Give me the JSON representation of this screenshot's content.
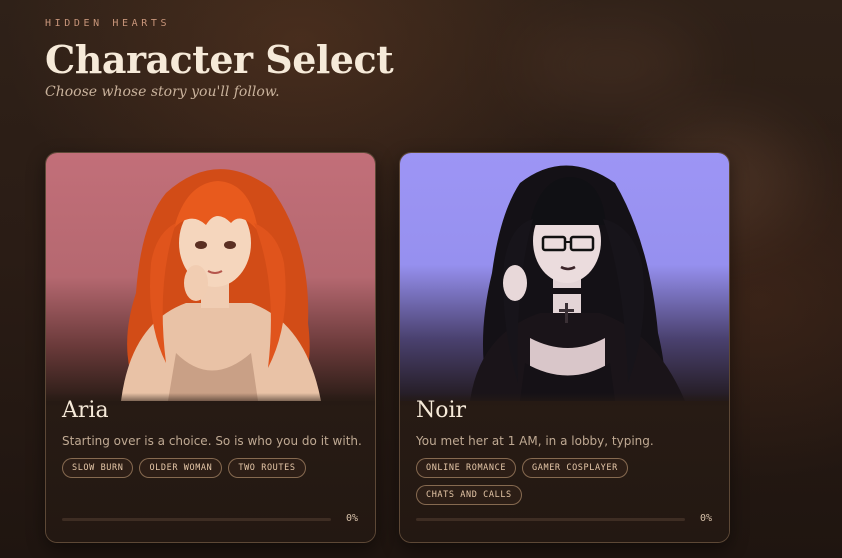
{
  "header": {
    "kicker": "HIDDEN HEARTS",
    "title": "Character Select",
    "subtitle": "Choose whose story you'll follow."
  },
  "characters": [
    {
      "name": "Aria",
      "tagline": "Starting over is a choice. So is who you do it with.",
      "tags": [
        "SLOW BURN",
        "OLDER WOMAN",
        "TWO ROUTES"
      ],
      "progress_label": "0%",
      "progress": 0,
      "art_bg": "#c26f79",
      "hair_color": "#e0541c",
      "portrait_icon": "red-haired-woman-portrait"
    },
    {
      "name": "Noir",
      "tagline": "You met her at 1 AM, in a lobby, typing.",
      "tags": [
        "ONLINE ROMANCE",
        "GAMER COSPLAYER",
        "CHATS AND CALLS"
      ],
      "progress_label": "0%",
      "progress": 0,
      "art_bg": "#9d95f5",
      "hair_color": "#121016",
      "portrait_icon": "goth-woman-with-glasses-portrait"
    }
  ]
}
